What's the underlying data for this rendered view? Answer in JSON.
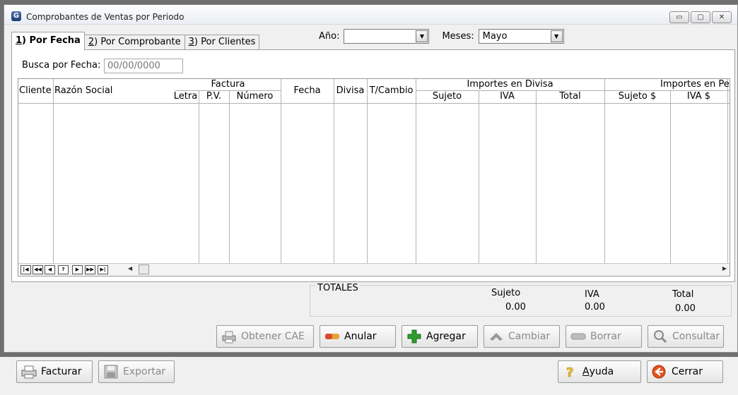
{
  "window": {
    "title": "Comprobantes de Ventas por Periodo",
    "app_icon_letter": "G"
  },
  "window_controls": {
    "minimize": "▭",
    "restore": "▢",
    "close": "✕"
  },
  "tabs": [
    {
      "key": "1",
      "label": ") Por Fecha",
      "active": true
    },
    {
      "key": "2",
      "label": ") Por Comprobante",
      "active": false
    },
    {
      "key": "3",
      "label": ") Por Clientes",
      "active": false
    }
  ],
  "filters": {
    "year_label": "Año:",
    "year_value": "",
    "months_label": "Meses:",
    "months_value": "Mayo"
  },
  "search": {
    "label": "Busca por Fecha:",
    "value": "00/00/0000"
  },
  "grid": {
    "group_headers": {
      "factura": "Factura",
      "importes_divisa": "Importes en Divisa",
      "importes_pesos": "Importes en Pe"
    },
    "columns": {
      "cliente": "Cliente",
      "razon_social": "Razón Social",
      "letra": "Letra",
      "pv": "P.V.",
      "numero": "Número",
      "fecha": "Fecha",
      "divisa": "Divisa",
      "tcambio": "T/Cambio",
      "sujeto": "Sujeto",
      "iva": "IVA",
      "total": "Total",
      "sujeto_pesos": "Sujeto $",
      "iva_pesos": "IVA $"
    },
    "rows": [],
    "nav_buttons": [
      "|◀",
      "◀◀",
      "◀",
      "?",
      "▶",
      "▶▶",
      "▶|"
    ]
  },
  "totals": {
    "label": "TOTALES",
    "sujeto_label": "Sujeto",
    "sujeto_value": "0.00",
    "iva_label": "IVA",
    "iva_value": "0.00",
    "total_label": "Total",
    "total_value": "0.00"
  },
  "actions": {
    "obtener_cae": "Obtener CAE",
    "anular": "Anular",
    "agregar": "Agregar",
    "cambiar": "Cambiar",
    "borrar": "Borrar",
    "consultar": "Consultar"
  },
  "footer": {
    "facturar": "Facturar",
    "exportar": "Exportar",
    "ayuda_key": "A",
    "ayuda_rest": "yuda",
    "cerrar": "Cerrar"
  },
  "colors": {
    "accent_blue": "#2a4f8f",
    "add_green": "#2d9c2d",
    "cerrar_orange": "#e0521e",
    "anular_red": "#d94b2b"
  }
}
